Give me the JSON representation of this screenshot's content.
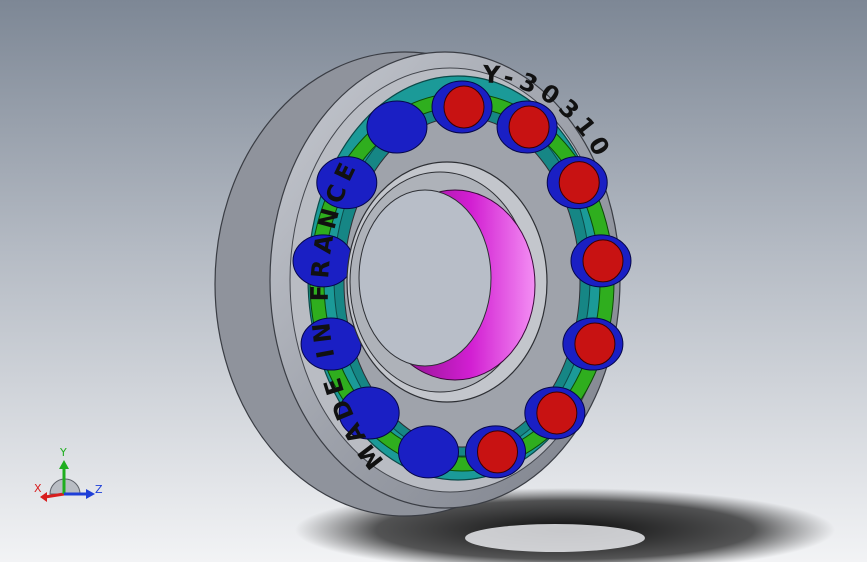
{
  "model": {
    "inscription_left": "MADE IN FRANCE",
    "inscription_right": "Y-30310"
  },
  "triad": {
    "x_label": "X",
    "y_label": "Y",
    "z_label": "Z"
  },
  "colors": {
    "background_top": "#7d8795",
    "background_bottom": "#f2f3f5",
    "outer_ring": "#a8abb3",
    "teal_face": "#1b9a98",
    "cage": "#2fae1e",
    "rollers": "#1a1fc4",
    "roller_ends": "#c81212",
    "inner_bore": "#d21fd2",
    "axis_x": "#d81e1e",
    "axis_y": "#1fae1f",
    "axis_z": "#1e3fd8"
  }
}
